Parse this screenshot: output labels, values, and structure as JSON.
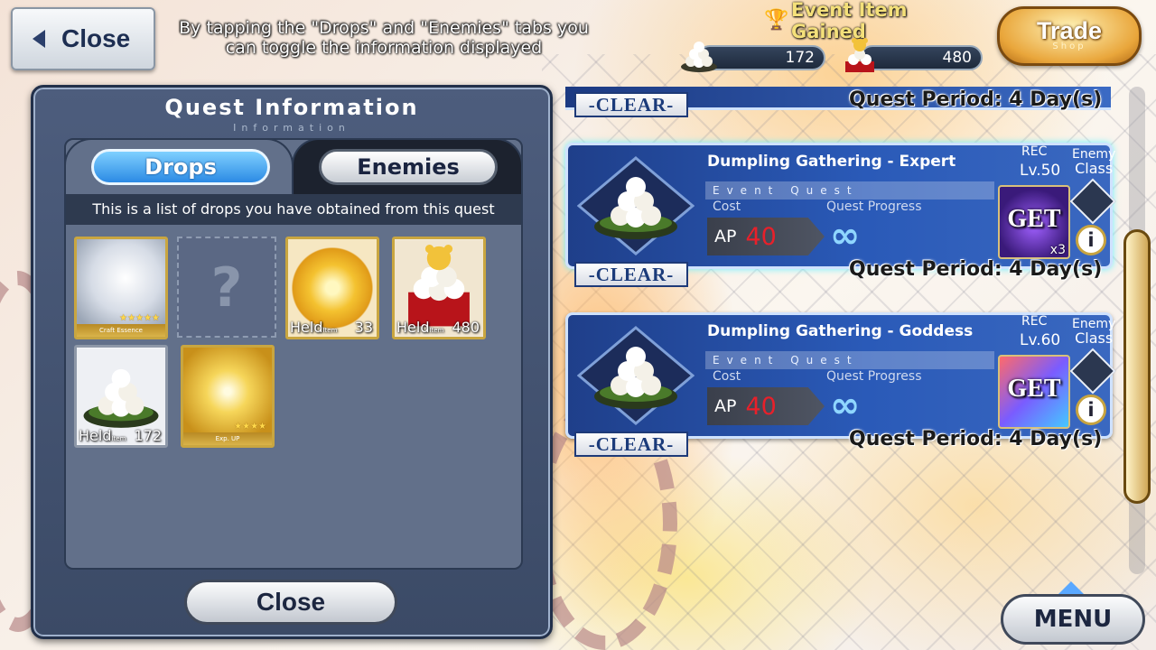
{
  "header": {
    "close_label": "Close",
    "hint": "By tapping the \"Drops\" and \"Enemies\" tabs you can toggle the information displayed",
    "event_item_gained": "Event Item Gained",
    "counters": [
      {
        "icon": "dumpling-icon",
        "value": "172"
      },
      {
        "icon": "bear-dumpling-icon",
        "value": "480"
      }
    ],
    "trade_label": "Trade",
    "trade_sub": "Shop"
  },
  "panel": {
    "title": "Quest Information",
    "subtitle": "Information",
    "tabs": [
      {
        "label": "Drops",
        "active": true
      },
      {
        "label": "Enemies",
        "active": false
      }
    ],
    "description": "This is a list of drops you have obtained from this quest",
    "drops": [
      {
        "icon": "craft-essence-card",
        "caption": "Craft Essence",
        "stars": "★★★★★"
      },
      {
        "icon": "unknown-item",
        "caption": "?"
      },
      {
        "icon": "gold-star-item",
        "held": "Held",
        "held_sub": "Item",
        "count": "33"
      },
      {
        "icon": "bear-dumpling-item",
        "held": "Held",
        "held_sub": "Item",
        "count": "480"
      },
      {
        "icon": "dumpling-item",
        "held": "Held",
        "held_sub": "Item",
        "count": "172"
      },
      {
        "icon": "exp-card",
        "caption": "Exp. UP",
        "stars": "★★★★"
      }
    ],
    "close_label": "Close"
  },
  "quests": [
    {
      "title": "Dumpling Gathering - Expert",
      "type": "Event Quest",
      "cost_label": "Cost",
      "ap_label": "AP",
      "ap": "40",
      "progress_label": "Quest Progress",
      "progress": "∞",
      "rec": "REC",
      "level": "Lv.50",
      "enemy_label": "Enemy",
      "class_label": "Class",
      "get": "GET",
      "multiplier": "x3",
      "clear": "-CLEAR-",
      "period": "Quest Period: 4 Day(s)"
    },
    {
      "title": "Dumpling Gathering - Goddess",
      "type": "Event Quest",
      "cost_label": "Cost",
      "ap_label": "AP",
      "ap": "40",
      "progress_label": "Quest Progress",
      "progress": "∞",
      "rec": "REC",
      "level": "Lv.60",
      "enemy_label": "Enemy",
      "class_label": "Class",
      "get": "GET",
      "multiplier": "",
      "clear": "-CLEAR-",
      "period": "Quest Period: 4 Day(s)"
    }
  ],
  "top_partial": {
    "clear": "-CLEAR-",
    "period": "Quest Period: 4 Day(s)"
  },
  "menu_label": "MENU",
  "colors": {
    "accent": "#2b8ae4",
    "panel": "#3b4a66",
    "gold": "#c9a640",
    "ap_red": "#e8202a"
  }
}
